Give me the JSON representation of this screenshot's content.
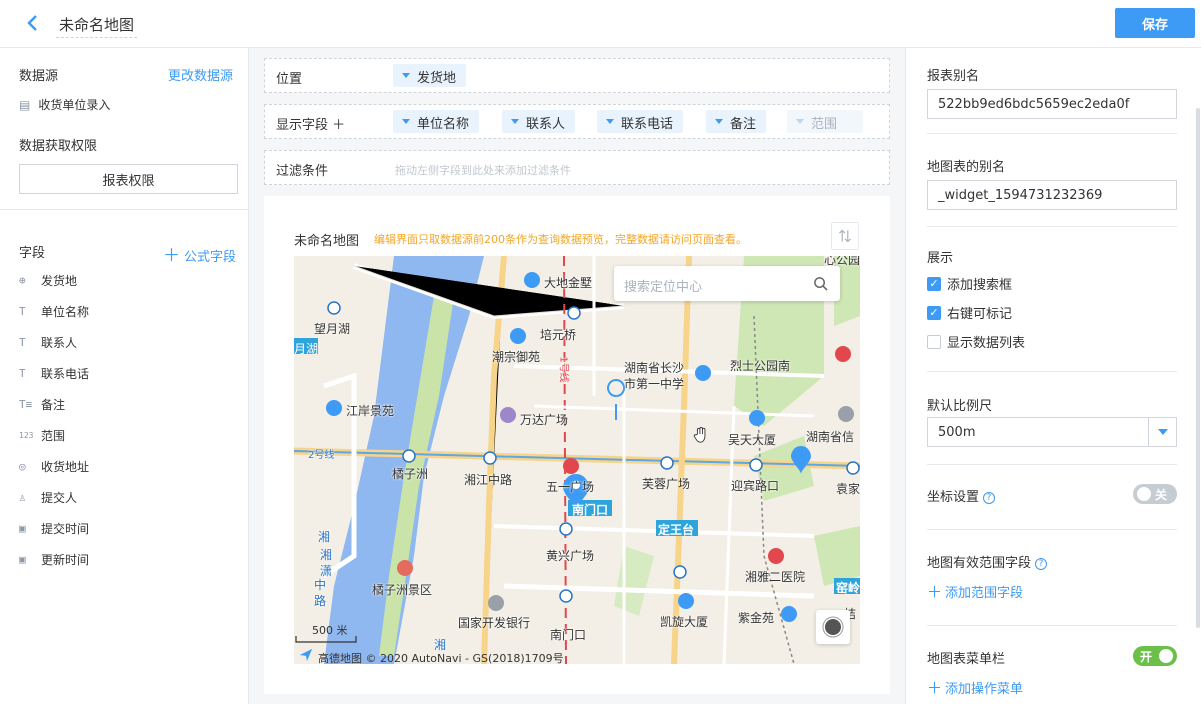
{
  "header": {
    "title": "未命名地图",
    "save_label": "保存"
  },
  "left": {
    "datasource_label": "数据源",
    "change_datasource": "更改数据源",
    "datasource_item": "收货单位录入",
    "permission_label": "数据获取权限",
    "permission_button": "报表权限",
    "fields_label": "字段",
    "formula_field": "公式字段",
    "fields": [
      {
        "icon": "location-icon",
        "glyph": "⊕",
        "label": "发货地"
      },
      {
        "icon": "text-icon",
        "glyph": "T",
        "label": "单位名称"
      },
      {
        "icon": "text-icon",
        "glyph": "T",
        "label": "联系人"
      },
      {
        "icon": "text-icon",
        "glyph": "T",
        "label": "联系电话"
      },
      {
        "icon": "text-area-icon",
        "glyph": "T≡",
        "label": "备注"
      },
      {
        "icon": "number-icon",
        "glyph": "123",
        "label": "范围"
      },
      {
        "icon": "map-pin-icon",
        "glyph": "◎",
        "label": "收货地址"
      },
      {
        "icon": "user-icon",
        "glyph": "♙",
        "label": "提交人"
      },
      {
        "icon": "calendar-icon",
        "glyph": "▣",
        "label": "提交时间"
      },
      {
        "icon": "calendar-icon",
        "glyph": "▣",
        "label": "更新时间"
      }
    ]
  },
  "middle": {
    "position_label": "位置",
    "position_value": "发货地",
    "display_label": "显示字段 ＋",
    "display_fields": [
      "单位名称",
      "联系人",
      "联系电话",
      "备注",
      "范围"
    ],
    "filter_label": "过滤条件",
    "filter_hint": "拖动左侧字段到此处来添加过滤条件",
    "card_title": "未命名地图",
    "card_note": "编辑界面只取数据源前200条作为查询数据预览，完整数据请访问页面查看。"
  },
  "map": {
    "search_placeholder": "搜索定位中心",
    "scale": "500 米",
    "copyright": "高德地图 © 2020 AutoNavi - GS(2018)1709号",
    "labels": [
      "大地金墅",
      "心公园",
      "培元桥",
      "望月湖",
      "湖南省长沙",
      "市第一中学",
      "潮宗御苑",
      "烈士公园南",
      "月湖",
      "江岸景苑",
      "万达广场",
      "吴天大厦",
      "湖南省信",
      "橘子洲",
      "湘江中路",
      "五一广场",
      "芙蓉广场",
      "迎宾路口",
      "袁家",
      "南门口",
      "定王台",
      "黄兴广场",
      "湘雅二医院",
      "橘子洲景区",
      "国家开发银行",
      "凯旋大厦",
      "紫金苑",
      "南门口",
      "2号线",
      "1号线",
      "湘",
      "潇",
      "湘",
      "中",
      "路",
      "湘",
      "窑岭",
      "桔"
    ]
  },
  "right": {
    "alias_label": "报表别名",
    "alias_value": "522bb9ed6bdc5659ec2eda0f",
    "map_alias_label": "地图表的别名",
    "map_alias_value": "_widget_1594731232369",
    "display_label": "展示",
    "options": [
      {
        "label": "添加搜索框",
        "checked": "✓"
      },
      {
        "label": "右键可标记",
        "checked": "✓"
      },
      {
        "label": "显示数据列表",
        "checked": ""
      }
    ],
    "scale_label": "默认比例尺",
    "scale_value": "500m",
    "coord_label": "坐标设置",
    "coord_toggle": "关",
    "range_label": "地图有效范围字段",
    "add_range": "添加范围字段",
    "menu_label": "地图表菜单栏",
    "menu_toggle": "开",
    "add_menu": "添加操作菜单",
    "help": "?"
  },
  "colors": {
    "accent": "#3d9af5",
    "toggle_on": "#6cc04a",
    "note": "#f5a623",
    "water": "#8fb8f0"
  }
}
